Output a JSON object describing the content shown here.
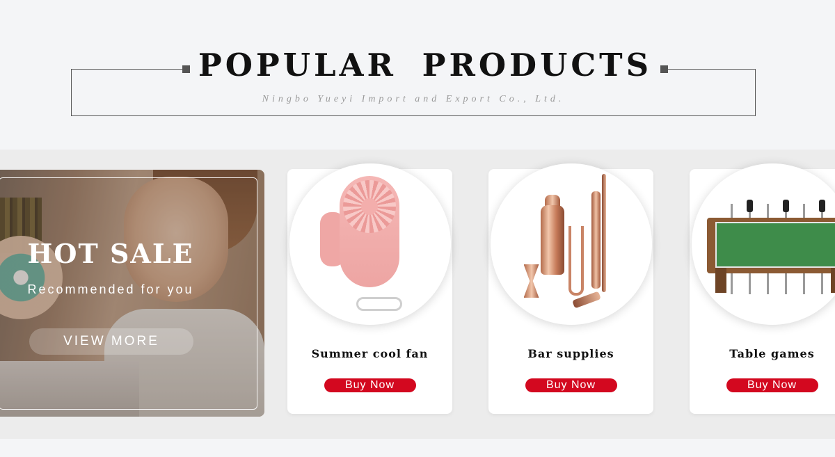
{
  "header": {
    "title": "POPULAR PRODUCTS",
    "subtitle": "Ningbo Yueyi Import and Export Co., Ltd."
  },
  "banner": {
    "title": "HOT SALE",
    "subtitle": "Recommended for you",
    "button_label": "VIEW MORE"
  },
  "products": [
    {
      "name": "Summer cool fan",
      "button_label": "Buy Now"
    },
    {
      "name": "Bar supplies",
      "button_label": "Buy Now"
    },
    {
      "name": "Table games",
      "button_label": "Buy Now"
    }
  ],
  "colors": {
    "page_bg": "#f4f5f7",
    "band_bg": "#ececec",
    "buy_button": "#d3081f",
    "title_text": "#111111"
  }
}
